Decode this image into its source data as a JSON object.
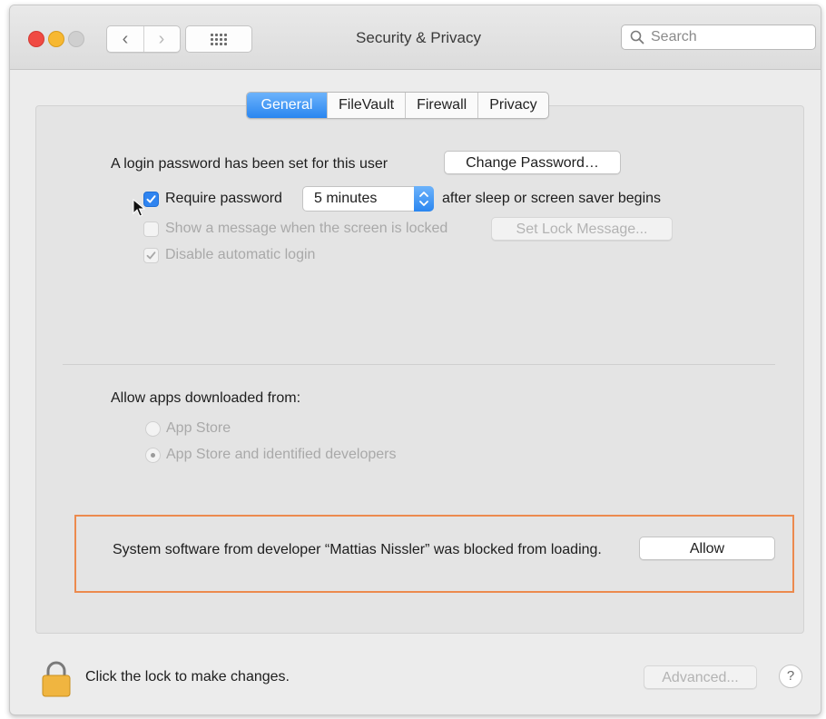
{
  "window": {
    "title": "Security & Privacy"
  },
  "search": {
    "placeholder": "Search"
  },
  "tabs": [
    {
      "label": "General",
      "active": true
    },
    {
      "label": "FileVault",
      "active": false
    },
    {
      "label": "Firewall",
      "active": false
    },
    {
      "label": "Privacy",
      "active": false
    }
  ],
  "login": {
    "text": "A login password has been set for this user",
    "change_password_label": "Change Password…"
  },
  "require_password": {
    "checked": true,
    "label": "Require password",
    "selected_value": "5 minutes",
    "suffix": "after sleep or screen saver begins"
  },
  "show_message": {
    "checked": false,
    "enabled": false,
    "label": "Show a message when the screen is locked",
    "button_label": "Set Lock Message..."
  },
  "disable_auto_login": {
    "checked": true,
    "enabled": false,
    "label": "Disable automatic login"
  },
  "allow_apps": {
    "heading": "Allow apps downloaded from:",
    "options": [
      {
        "label": "App Store",
        "selected": false
      },
      {
        "label": "App Store and identified developers",
        "selected": true
      }
    ]
  },
  "blocked": {
    "message": "System software from developer “Mattias Nissler” was blocked from loading.",
    "allow_label": "Allow"
  },
  "footer": {
    "lock_text": "Click the lock to make changes.",
    "advanced_label": "Advanced...",
    "help_label": "?"
  },
  "colors": {
    "accent": "#2f84f0",
    "highlight_border": "#ec8a4e",
    "lock": "#f0b540"
  }
}
